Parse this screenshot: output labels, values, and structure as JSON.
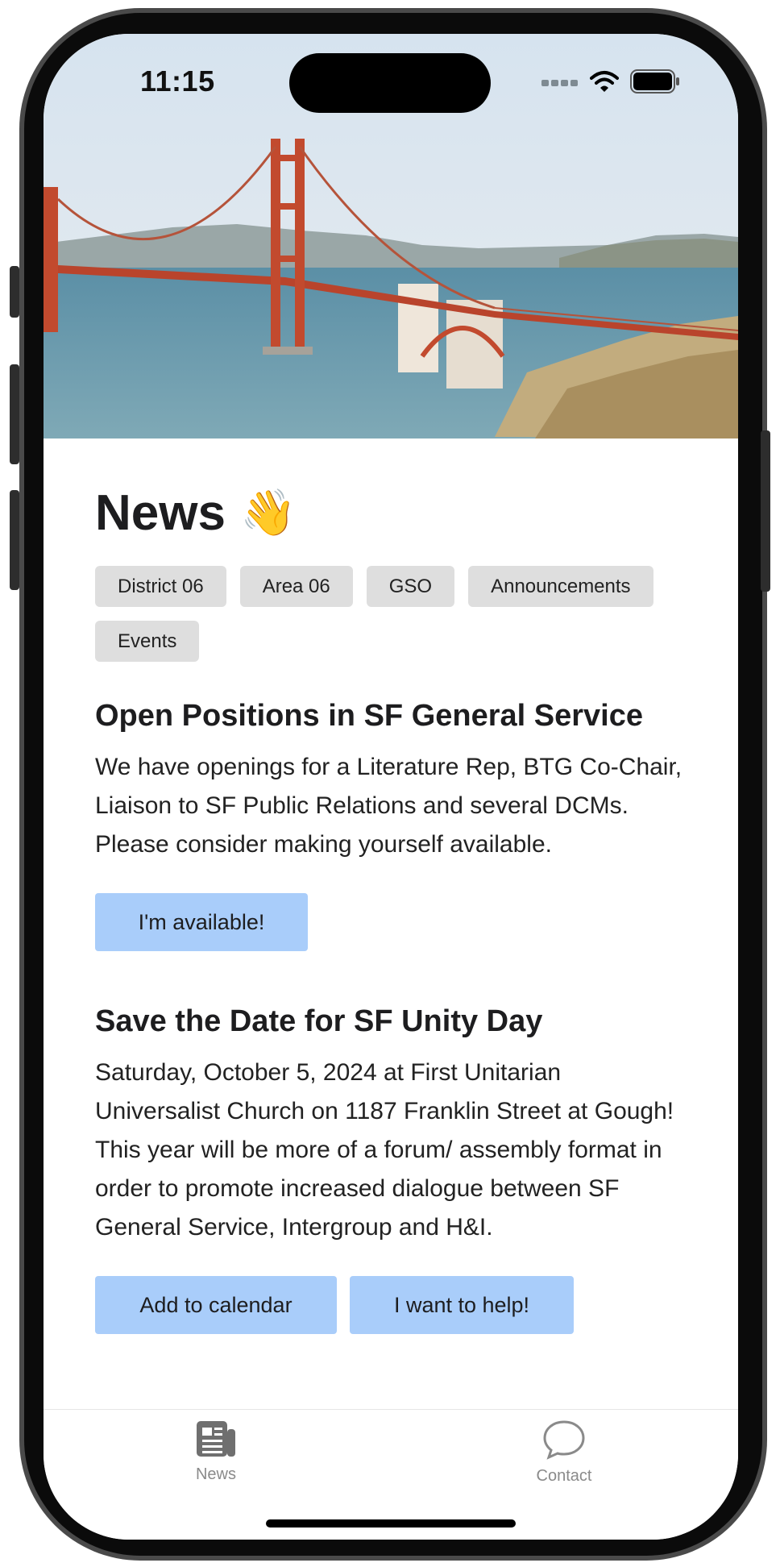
{
  "status_bar": {
    "time": "11:15"
  },
  "page": {
    "title": "News",
    "title_emoji": "👋"
  },
  "tags": [
    "District 06",
    "Area 06",
    "GSO",
    "Announcements",
    "Events"
  ],
  "articles": [
    {
      "title": "Open Positions in SF General Service",
      "body": "We have openings for a Literature Rep, BTG Co-Chair, Liaison to SF Public Relations and several DCMs.  Please consider making yourself available.",
      "buttons": [
        "I'm available!"
      ]
    },
    {
      "title": "Save the Date for SF Unity Day",
      "body": "Saturday, October 5, 2024 at First Unitarian Universalist Church on 1187 Franklin Street at Gough!  This year will be more of a forum/ assembly format in order to promote increased dialogue between SF General Service, Intergroup and H&I.",
      "buttons": [
        "Add to calendar",
        "I want to help!"
      ]
    }
  ],
  "tabbar": {
    "news_label": "News",
    "contact_label": "Contact"
  },
  "icons": {
    "hero": "golden-gate-bridge-photo",
    "news": "newspaper-icon",
    "contact": "speech-bubble-icon",
    "signal": "cellular-signal-icon",
    "wifi": "wifi-icon",
    "battery": "battery-icon"
  },
  "colors": {
    "button": "#a9cdfa",
    "tag": "#dedede",
    "tab_inactive": "#8a8a8a"
  }
}
